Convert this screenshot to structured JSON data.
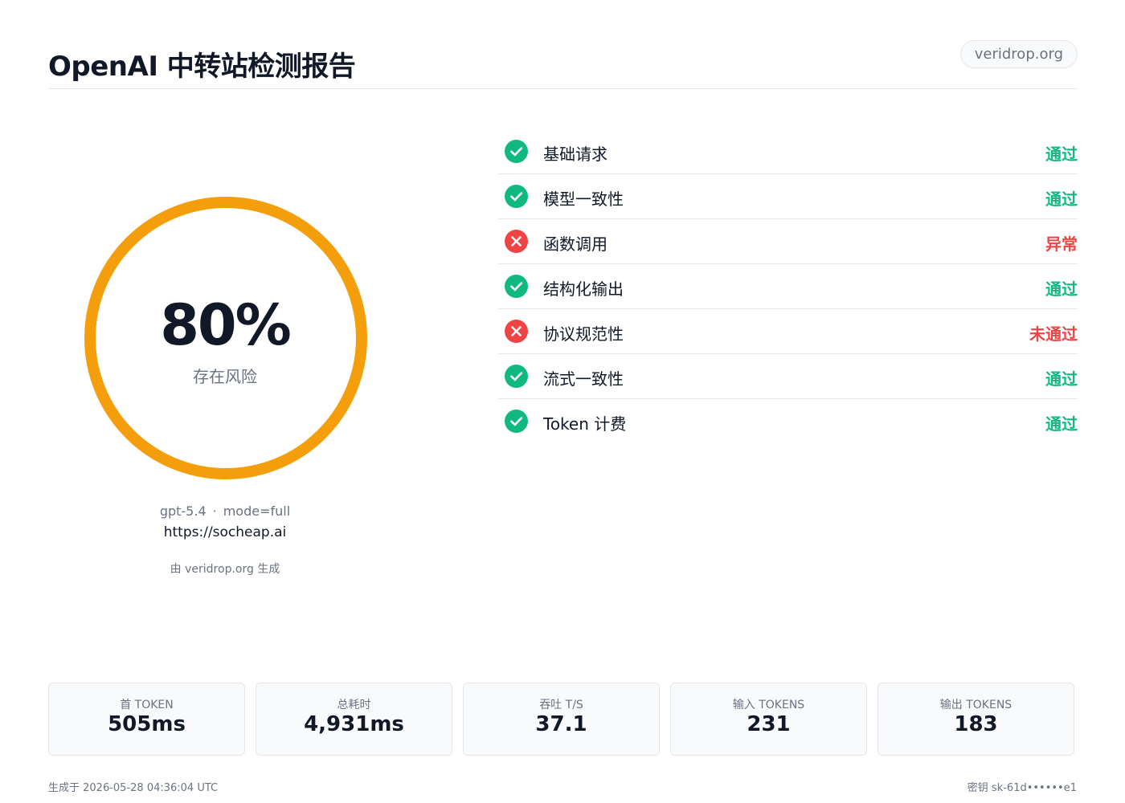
{
  "header": {
    "title": "OpenAI 中转站检测报告",
    "domain": "veridrop.org"
  },
  "score": {
    "value": "80%",
    "label": "存在风险",
    "ring_color": "#f59e0b",
    "model": "gpt-5.4",
    "separator": "·",
    "mode": "mode=full",
    "url": "https://socheap.ai",
    "generator": "由 veridrop.org 生成"
  },
  "checks": [
    {
      "label": "基础请求",
      "status": "通过",
      "result": "pass",
      "icon": "check-icon"
    },
    {
      "label": "模型一致性",
      "status": "通过",
      "result": "pass",
      "icon": "check-icon"
    },
    {
      "label": "函数调用",
      "status": "异常",
      "result": "fail",
      "icon": "x-icon"
    },
    {
      "label": "结构化输出",
      "status": "通过",
      "result": "pass",
      "icon": "check-icon"
    },
    {
      "label": "协议规范性",
      "status": "未通过",
      "result": "fail",
      "icon": "x-icon"
    },
    {
      "label": "流式一致性",
      "status": "通过",
      "result": "pass",
      "icon": "check-icon"
    },
    {
      "label": "Token 计费",
      "status": "通过",
      "result": "pass",
      "icon": "check-icon"
    }
  ],
  "stats": [
    {
      "label": "首 TOKEN",
      "value": "505ms"
    },
    {
      "label": "总耗时",
      "value": "4,931ms"
    },
    {
      "label": "吞吐 T/S",
      "value": "37.1"
    },
    {
      "label": "输入 TOKENS",
      "value": "231"
    },
    {
      "label": "输出 TOKENS",
      "value": "183"
    }
  ],
  "footer": {
    "generated": "生成于 2026-05-28 04:36:04 UTC",
    "key": "密钥 sk-61d••••••e1"
  },
  "colors": {
    "pass": "#10b981",
    "fail": "#ef4444",
    "accent": "#f59e0b"
  }
}
